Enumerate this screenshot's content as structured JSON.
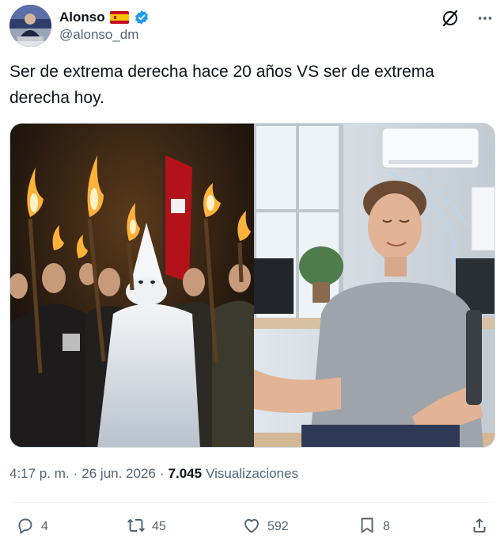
{
  "author": {
    "display_name": "Alonso",
    "handle": "@alonso_dm",
    "flag_icon": "spain-flag-icon",
    "verified_icon": "verified-badge-icon",
    "verified_color": "#1d9bf0"
  },
  "top_actions": {
    "grok_icon": "grok-icon",
    "more_icon": "more-horizontal-icon"
  },
  "tweet": {
    "text": "Ser de extrema derecha hace 20 años VS ser de extrema derecha hoy."
  },
  "meta": {
    "time": "4:17 p. m.",
    "separator": "·",
    "date": "26 jun. 2026",
    "separator2": "·",
    "views_count": "7.045",
    "views_label": "Visualizaciones"
  },
  "actions": {
    "replies": "4",
    "reposts": "45",
    "likes": "592",
    "bookmarks": "8"
  },
  "colors": {
    "text_primary": "#0f1419",
    "text_secondary": "#536471",
    "border": "#cfd9de"
  }
}
